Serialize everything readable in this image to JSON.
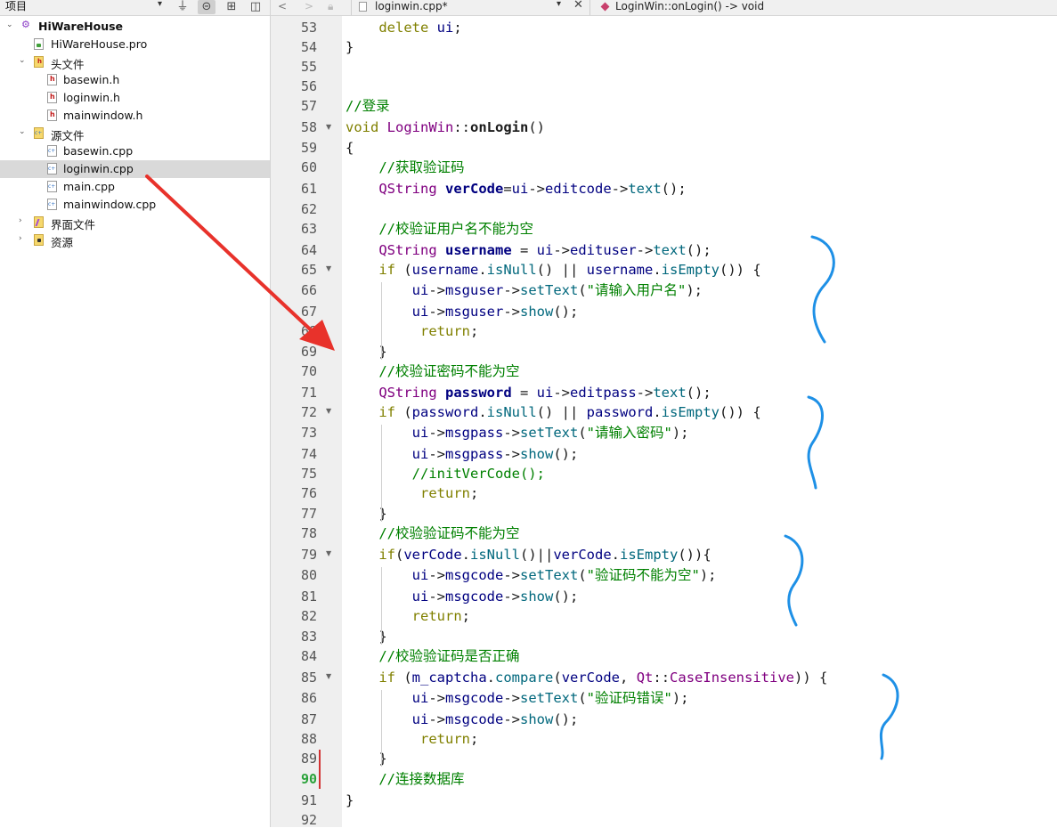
{
  "project_panel": {
    "combo_label": "项目",
    "tree": [
      {
        "label": "HiWareHouse",
        "level": 0,
        "expanded": true,
        "icon": "project-icon"
      },
      {
        "label": "HiWareHouse.pro",
        "level": 1,
        "icon": "pro-file-icon"
      },
      {
        "label": "头文件",
        "level": 1,
        "expanded": true,
        "icon": "header-folder-icon"
      },
      {
        "label": "basewin.h",
        "level": 2,
        "icon": "header-file-icon"
      },
      {
        "label": "loginwin.h",
        "level": 2,
        "icon": "header-file-icon"
      },
      {
        "label": "mainwindow.h",
        "level": 2,
        "icon": "header-file-icon"
      },
      {
        "label": "源文件",
        "level": 1,
        "expanded": true,
        "icon": "source-folder-icon"
      },
      {
        "label": "basewin.cpp",
        "level": 2,
        "icon": "cpp-file-icon"
      },
      {
        "label": "loginwin.cpp",
        "level": 2,
        "icon": "cpp-file-icon",
        "selected": true
      },
      {
        "label": "main.cpp",
        "level": 2,
        "icon": "cpp-file-icon"
      },
      {
        "label": "mainwindow.cpp",
        "level": 2,
        "icon": "cpp-file-icon"
      },
      {
        "label": "界面文件",
        "level": 1,
        "expanded": false,
        "icon": "forms-folder-icon"
      },
      {
        "label": "资源",
        "level": 1,
        "expanded": false,
        "icon": "resources-folder-icon"
      }
    ]
  },
  "editor": {
    "file_combo": "loginwin.cpp*",
    "symbol_combo": "LoginWin::onLogin() -> void",
    "current_line": "90"
  },
  "code_lines": [
    {
      "n": "53",
      "text": "    delete ui;"
    },
    {
      "n": "54",
      "text": "}"
    },
    {
      "n": "55",
      "text": ""
    },
    {
      "n": "56",
      "text": ""
    },
    {
      "n": "57",
      "text": "//登录"
    },
    {
      "n": "58",
      "text": "void LoginWin::onLogin()"
    },
    {
      "n": "59",
      "text": "{"
    },
    {
      "n": "60",
      "text": "    //获取验证码"
    },
    {
      "n": "61",
      "text": "    QString verCode=ui->editcode->text();"
    },
    {
      "n": "62",
      "text": ""
    },
    {
      "n": "63",
      "text": "    //校验证用户名不能为空"
    },
    {
      "n": "64",
      "text": "    QString username = ui->edituser->text();"
    },
    {
      "n": "65",
      "text": "    if (username.isNull() || username.isEmpty()) {"
    },
    {
      "n": "66",
      "text": "        ui->msguser->setText(\"请输入用户名\");"
    },
    {
      "n": "67",
      "text": "        ui->msguser->show();"
    },
    {
      "n": "68",
      "text": "         return;"
    },
    {
      "n": "69",
      "text": "    }"
    },
    {
      "n": "70",
      "text": "    //校验证密码不能为空"
    },
    {
      "n": "71",
      "text": "    QString password = ui->editpass->text();"
    },
    {
      "n": "72",
      "text": "    if (password.isNull() || password.isEmpty()) {"
    },
    {
      "n": "73",
      "text": "        ui->msgpass->setText(\"请输入密码\");"
    },
    {
      "n": "74",
      "text": "        ui->msgpass->show();"
    },
    {
      "n": "75",
      "text": "        //initVerCode();"
    },
    {
      "n": "76",
      "text": "         return;"
    },
    {
      "n": "77",
      "text": "    }"
    },
    {
      "n": "78",
      "text": "    //校验验证码不能为空"
    },
    {
      "n": "79",
      "text": "    if(verCode.isNull()||verCode.isEmpty()){"
    },
    {
      "n": "80",
      "text": "        ui->msgcode->setText(\"验证码不能为空\");"
    },
    {
      "n": "81",
      "text": "        ui->msgcode->show();"
    },
    {
      "n": "82",
      "text": "        return;"
    },
    {
      "n": "83",
      "text": "    }"
    },
    {
      "n": "84",
      "text": "    //校验验证码是否正确"
    },
    {
      "n": "85",
      "text": "    if (m_captcha.compare(verCode, Qt::CaseInsensitive)) {"
    },
    {
      "n": "86",
      "text": "        ui->msgcode->setText(\"验证码错误\");"
    },
    {
      "n": "87",
      "text": "        ui->msgcode->show();"
    },
    {
      "n": "88",
      "text": "         return;"
    },
    {
      "n": "89",
      "text": "    }"
    },
    {
      "n": "90",
      "text": "    //连接数据库"
    },
    {
      "n": "91",
      "text": "}"
    },
    {
      "n": "92",
      "text": ""
    }
  ],
  "colors": {
    "keyword": "#808000",
    "type": "#800080",
    "member": "#000080",
    "function": "#00677c",
    "string": "#008000",
    "comment": "#008000",
    "annotation_arrow": "#e8322b",
    "annotation_brace": "#1e90e6"
  }
}
